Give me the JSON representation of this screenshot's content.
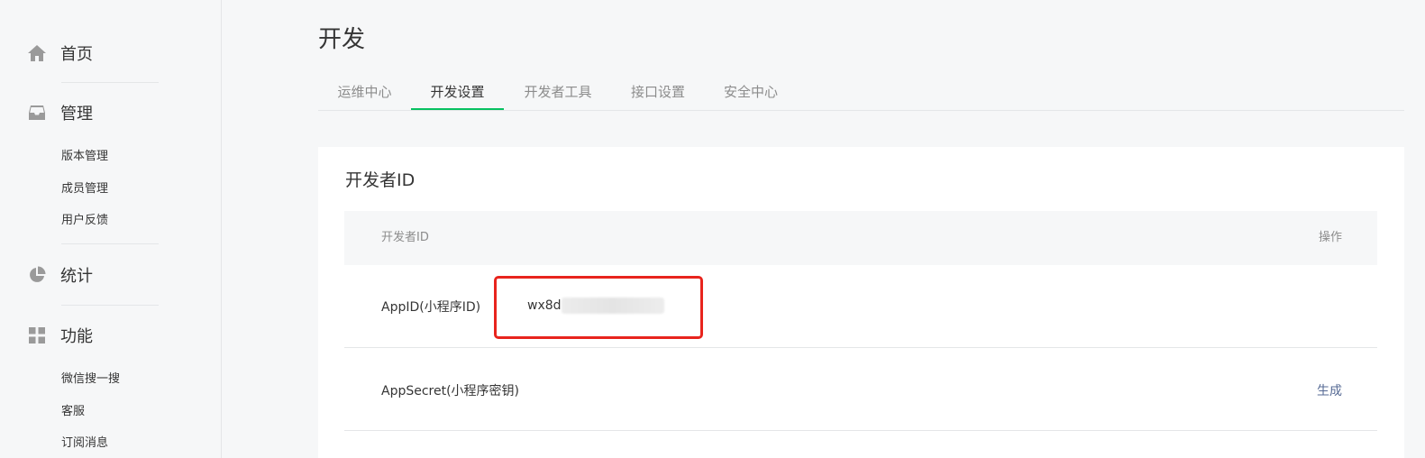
{
  "sidebar": {
    "home": {
      "label": "首页",
      "icon": "home-icon"
    },
    "manage": {
      "label": "管理",
      "icon": "inbox-icon"
    },
    "manage_items": [
      {
        "label": "版本管理"
      },
      {
        "label": "成员管理"
      },
      {
        "label": "用户反馈"
      }
    ],
    "stats": {
      "label": "统计",
      "icon": "pie-chart-icon"
    },
    "features": {
      "label": "功能",
      "icon": "grid-icon"
    },
    "feature_items": [
      {
        "label": "微信搜一搜"
      },
      {
        "label": "客服"
      },
      {
        "label": "订阅消息"
      }
    ]
  },
  "page": {
    "title": "开发"
  },
  "tabs": [
    {
      "label": "运维中心"
    },
    {
      "label": "开发设置"
    },
    {
      "label": "开发者工具"
    },
    {
      "label": "接口设置"
    },
    {
      "label": "安全中心"
    }
  ],
  "active_tab": "开发设置",
  "card": {
    "title": "开发者ID",
    "columns": {
      "id": "开发者ID",
      "action": "操作"
    },
    "rows": [
      {
        "name": "AppID(小程序ID)",
        "value": "wx8d",
        "action": ""
      },
      {
        "name": "AppSecret(小程序密钥)",
        "value": "",
        "action": "生成"
      }
    ]
  },
  "colors": {
    "accent": "#07c160",
    "link": "#576b95",
    "highlight": "#e8241d"
  }
}
